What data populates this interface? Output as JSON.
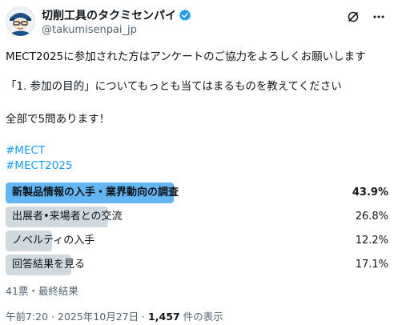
{
  "author": {
    "display_name": "切削工具のタクミセンパイ",
    "handle": "@takumisenpai_jp"
  },
  "icons": {
    "avatar": "character-avatar",
    "verified": "verified-badge-icon",
    "grok": "grok-icon",
    "more": "more-options-icon"
  },
  "tweet": {
    "line1": "MECT2025に参加された方はアンケートのご協力をよろしくお願いします",
    "line2": "「1. 参加の目的」についてもっとも当てはまるものを教えてください",
    "line3": "全部で5問あります！",
    "hashtags": [
      "#MECT",
      "#MECT2025"
    ]
  },
  "poll": {
    "options": [
      {
        "label": "新製品情報の入手・業界動向の調査",
        "percent_text": "43.9%",
        "percent": 43.9,
        "winner": true
      },
      {
        "label": "出展者•来場者との交流",
        "percent_text": "26.8%",
        "percent": 26.8,
        "winner": false
      },
      {
        "label": "ノベルティの入手",
        "percent_text": "12.2%",
        "percent": 12.2,
        "winner": false
      },
      {
        "label": "回答結果を見る",
        "percent_text": "17.1%",
        "percent": 17.1,
        "winner": false
      }
    ],
    "meta": "41票・最終結果"
  },
  "footer": {
    "time_date": "午前7:20 · 2025年10月27日 · ",
    "views_count": "1,457",
    "views_suffix": " 件の表示"
  },
  "colors": {
    "accent": "#1d9bf0",
    "winner_bar": "#63b5f4",
    "bar": "#cfd9de",
    "secondary_text": "#536471"
  }
}
